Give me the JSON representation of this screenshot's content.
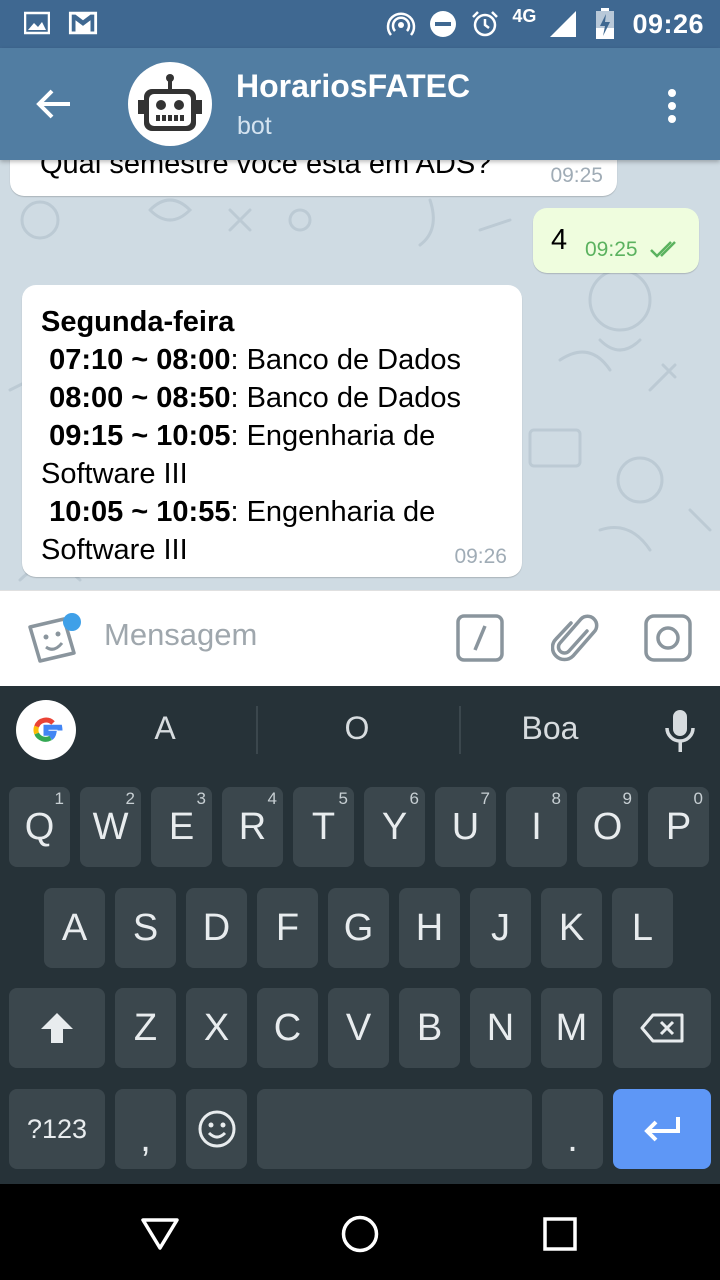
{
  "status_bar": {
    "network": "4G",
    "time": "09:26",
    "icons": [
      "image-icon",
      "gmail-icon",
      "hotspot-icon",
      "dnd-icon",
      "alarm-icon",
      "signal-icon",
      "battery-icon"
    ]
  },
  "header": {
    "title": "HorariosFATEC",
    "subtitle": "bot",
    "colors": {
      "status": "#3f6891",
      "bar": "#517da2"
    }
  },
  "messages": [
    {
      "direction": "in",
      "text": "Qual semestre você está em ADS?",
      "time": "09:25"
    },
    {
      "direction": "out",
      "text": "4",
      "time": "09:25",
      "read": true
    },
    {
      "direction": "in",
      "day": "Segunda-feira",
      "lines": [
        {
          "slot": "07:10 ~ 08:00",
          "subject": ": Banco de Dados"
        },
        {
          "slot": "08:00 ~ 08:50",
          "subject": ": Banco de Dados"
        },
        {
          "slot": "09:15 ~ 10:05",
          "subject": ": Engenharia de Software III"
        },
        {
          "slot": "10:05 ~ 10:55",
          "subject": ": Engenharia de Software III"
        }
      ],
      "time": "09:26"
    }
  ],
  "composer": {
    "placeholder": "Mensagem"
  },
  "keyboard": {
    "suggestions": [
      "A",
      "O",
      "Boa"
    ],
    "row1": [
      {
        "k": "Q",
        "h": "1"
      },
      {
        "k": "W",
        "h": "2"
      },
      {
        "k": "E",
        "h": "3"
      },
      {
        "k": "R",
        "h": "4"
      },
      {
        "k": "T",
        "h": "5"
      },
      {
        "k": "Y",
        "h": "6"
      },
      {
        "k": "U",
        "h": "7"
      },
      {
        "k": "I",
        "h": "8"
      },
      {
        "k": "O",
        "h": "9"
      },
      {
        "k": "P",
        "h": "0"
      }
    ],
    "row2": [
      "A",
      "S",
      "D",
      "F",
      "G",
      "H",
      "J",
      "K",
      "L"
    ],
    "row3": [
      "Z",
      "X",
      "C",
      "V",
      "B",
      "N",
      "M"
    ],
    "symbols_label": "?123",
    "comma": ",",
    "period": "."
  }
}
